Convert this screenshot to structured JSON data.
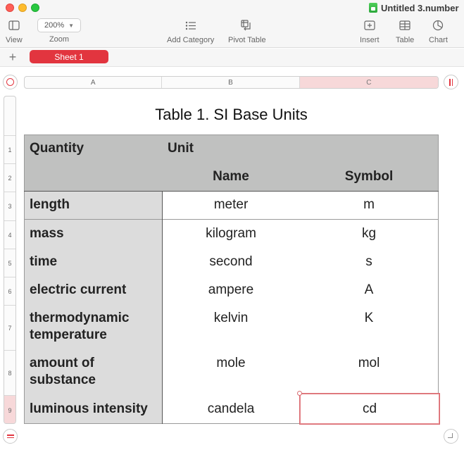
{
  "window": {
    "title": "Untitled 3.number"
  },
  "toolbar": {
    "view_label": "View",
    "zoom_label": "Zoom",
    "zoom_value": "200%",
    "add_category_label": "Add Category",
    "pivot_table_label": "Pivot Table",
    "insert_label": "Insert",
    "table_label": "Table",
    "chart_label": "Chart"
  },
  "sheets": [
    {
      "label": "Sheet 1",
      "active": true
    }
  ],
  "columns": [
    "A",
    "B",
    "C"
  ],
  "selected_column": "C",
  "rows": [
    "1",
    "2",
    "3",
    "4",
    "5",
    "6",
    "7",
    "8",
    "9"
  ],
  "selected_row": "9",
  "table": {
    "title": "Table 1. SI Base Units",
    "header": {
      "quantity": "Quantity",
      "unit": "Unit",
      "name": "Name",
      "symbol": "Symbol"
    },
    "rows": [
      {
        "quantity": "length",
        "name": "meter",
        "symbol": "m"
      },
      {
        "quantity": "mass",
        "name": "kilogram",
        "symbol": "kg"
      },
      {
        "quantity": "time",
        "name": "second",
        "symbol": "s"
      },
      {
        "quantity": "electric current",
        "name": "ampere",
        "symbol": "A"
      },
      {
        "quantity": "thermodynamic temperature",
        "name": "kelvin",
        "symbol": "K"
      },
      {
        "quantity": "amount of substance",
        "name": "mole",
        "symbol": "mol"
      },
      {
        "quantity": "luminous intensity",
        "name": "candela",
        "symbol": "cd"
      }
    ]
  },
  "colors": {
    "accent": "#e2353f",
    "header_fill": "#c0c1c0",
    "label_fill": "#dcdcdc"
  }
}
